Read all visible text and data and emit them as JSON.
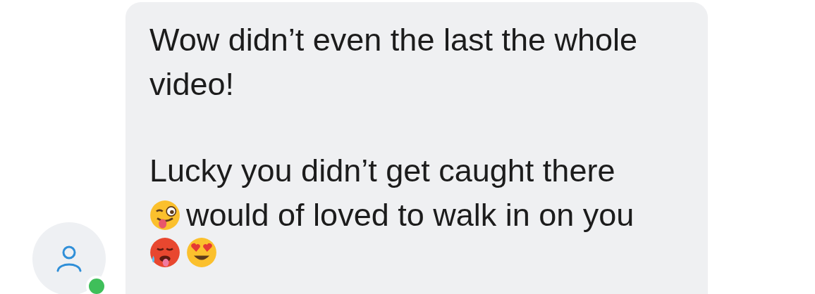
{
  "message": {
    "paragraphs": [
      {
        "lines": [
          "Wow didn’t even the last the whole video!"
        ]
      },
      {
        "lines": [
          "Lucky you didn’t get caught there",
          "would of loved to walk in on you"
        ]
      }
    ]
  },
  "sender": {
    "online": true
  }
}
